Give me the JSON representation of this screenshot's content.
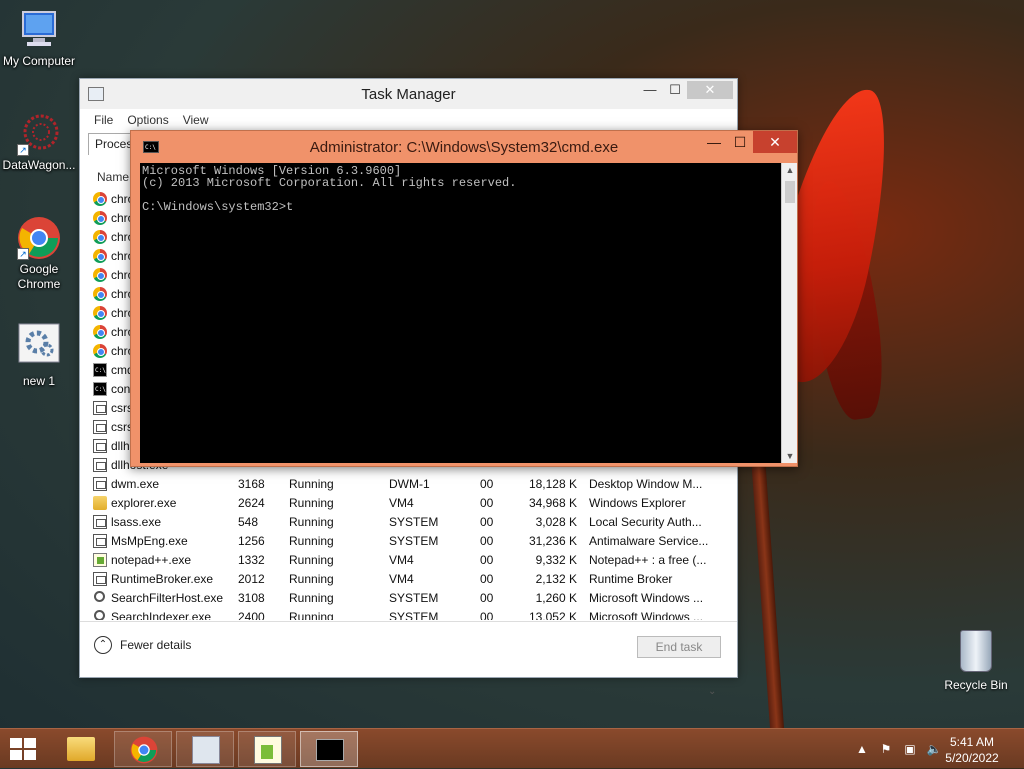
{
  "desktop": {
    "icons": [
      {
        "label": "My Computer"
      },
      {
        "label": "DataWagon..."
      },
      {
        "label": "Google Chrome"
      },
      {
        "label": "new 1"
      }
    ],
    "recycle_bin": "Recycle Bin"
  },
  "task_manager": {
    "title": "Task Manager",
    "menu": [
      "File",
      "Options",
      "View"
    ],
    "tab": "Processes",
    "column_name": "Name",
    "partial_rows": [
      {
        "icon": "chrome-icon",
        "name": "chrome.exe"
      },
      {
        "icon": "chrome-icon",
        "name": "chrome.exe"
      },
      {
        "icon": "chrome-icon",
        "name": "chrome.exe"
      },
      {
        "icon": "chrome-icon",
        "name": "chrome.exe"
      },
      {
        "icon": "chrome-icon",
        "name": "chrome.exe"
      },
      {
        "icon": "chrome-icon",
        "name": "chrome.exe"
      },
      {
        "icon": "chrome-icon",
        "name": "chrome.exe"
      },
      {
        "icon": "chrome-icon",
        "name": "chrome.exe"
      },
      {
        "icon": "chrome-icon",
        "name": "chrome.exe"
      },
      {
        "icon": "cmd-icon",
        "name": "cmd.exe"
      },
      {
        "icon": "console-icon",
        "name": "conhost.exe"
      },
      {
        "icon": "window-icon",
        "name": "csrss.exe"
      },
      {
        "icon": "window-icon",
        "name": "csrss.exe"
      },
      {
        "icon": "window-icon",
        "name": "dllhost.exe"
      },
      {
        "icon": "window-icon",
        "name": "dllhost.exe"
      }
    ],
    "rows": [
      {
        "icon": "window-icon",
        "name": "dwm.exe",
        "pid": "3168",
        "status": "Running",
        "user": "DWM-1",
        "cpu": "00",
        "memory": "18,128 K",
        "desc": "Desktop Window M..."
      },
      {
        "icon": "folder-icon",
        "name": "explorer.exe",
        "pid": "2624",
        "status": "Running",
        "user": "VM4",
        "cpu": "00",
        "memory": "34,968 K",
        "desc": "Windows Explorer"
      },
      {
        "icon": "window-icon",
        "name": "lsass.exe",
        "pid": "548",
        "status": "Running",
        "user": "SYSTEM",
        "cpu": "00",
        "memory": "3,028 K",
        "desc": "Local Security Auth..."
      },
      {
        "icon": "window-icon",
        "name": "MsMpEng.exe",
        "pid": "1256",
        "status": "Running",
        "user": "SYSTEM",
        "cpu": "00",
        "memory": "31,236 K",
        "desc": "Antimalware Service..."
      },
      {
        "icon": "notepad-icon",
        "name": "notepad++.exe",
        "pid": "1332",
        "status": "Running",
        "user": "VM4",
        "cpu": "00",
        "memory": "9,332 K",
        "desc": "Notepad++ : a free (..."
      },
      {
        "icon": "window-icon",
        "name": "RuntimeBroker.exe",
        "pid": "2012",
        "status": "Running",
        "user": "VM4",
        "cpu": "00",
        "memory": "2,132 K",
        "desc": "Runtime Broker"
      },
      {
        "icon": "search-icon",
        "name": "SearchFilterHost.exe",
        "pid": "3108",
        "status": "Running",
        "user": "SYSTEM",
        "cpu": "00",
        "memory": "1,260 K",
        "desc": "Microsoft Windows ..."
      },
      {
        "icon": "search-icon",
        "name": "SearchIndexer.exe",
        "pid": "2400",
        "status": "Running",
        "user": "SYSTEM",
        "cpu": "00",
        "memory": "13,052 K",
        "desc": "Microsoft Windows ..."
      }
    ],
    "fewer_details": "Fewer details",
    "end_task": "End task"
  },
  "cmd": {
    "title": "Administrator: C:\\Windows\\System32\\cmd.exe",
    "lines": [
      "Microsoft Windows [Version 6.3.9600]",
      "(c) 2013 Microsoft Corporation. All rights reserved.",
      "",
      "C:\\Windows\\system32>t"
    ]
  },
  "taskbar": {
    "buttons": [
      "file-explorer-icon",
      "chrome-icon",
      "task-manager-icon",
      "notepad-plus-icon",
      "cmd-icon"
    ],
    "time": "5:41 AM",
    "date": "5/20/2022"
  }
}
